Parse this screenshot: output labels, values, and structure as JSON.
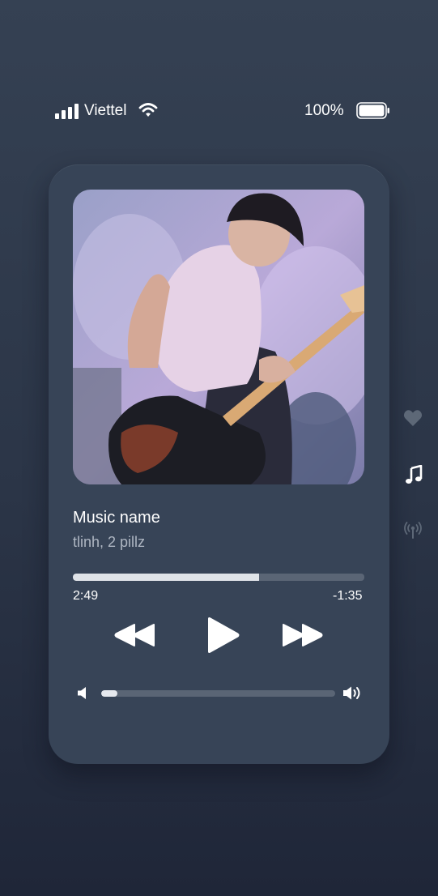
{
  "status_bar": {
    "carrier": "Viettel",
    "battery_percent": "100%",
    "signal_icon": "signal-bars-icon",
    "wifi_icon": "wifi-icon",
    "battery_icon": "battery-full-icon"
  },
  "player": {
    "song_title": "Music name",
    "artist": "tlinh, 2 pillz",
    "elapsed": "2:49",
    "remaining": "-1:35",
    "progress_fraction": 0.64,
    "volume_fraction": 0.07,
    "artwork": "album-artwork-guitarist",
    "controls": {
      "rewind_icon": "rewind-icon",
      "play_icon": "play-icon",
      "forward_icon": "fast-forward-icon"
    },
    "volume_low_icon": "speaker-low-icon",
    "volume_high_icon": "speaker-high-icon"
  },
  "side_nav": [
    {
      "icon": "heart-icon",
      "active": false
    },
    {
      "icon": "music-note-icon",
      "active": true
    },
    {
      "icon": "broadcast-icon",
      "active": false
    }
  ],
  "colors": {
    "background": "#2b3547",
    "card": "#374457",
    "track": "#5a6575",
    "fill": "#dfe3e8",
    "secondary_text": "#aeb6c2",
    "inactive_icon": "#5d6877"
  }
}
